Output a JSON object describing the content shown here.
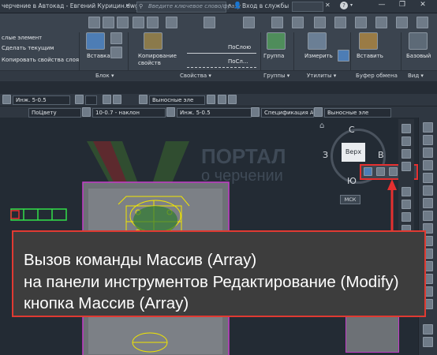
{
  "window": {
    "title": "черчение в Автокад - Евгений Курицин.dwg",
    "search_placeholder": "Введите ключевое слово/фразу",
    "signin": "Вход в службы",
    "help": "?"
  },
  "ribbon": {
    "layer_items": [
      "слые элемент",
      "Сделать текущим",
      "Копировать свойства слоя"
    ],
    "insert_label": "Вставка",
    "copy_props_label": "Копирование свойств",
    "by_layer_1": "ПоСлою",
    "by_layer_2": "ПоСл...",
    "group_label": "Группа",
    "measure_label": "Измерить",
    "paste_label": "Вставить",
    "base_label": "Базовый",
    "panels": [
      "Блок ▾",
      "Свойства ▾",
      "Группы ▾",
      "Утилиты ▾",
      "Буфер обмена",
      "Вид ▾"
    ]
  },
  "toolbar1": {
    "layer_combo": "Инж. 5-0.5",
    "mleader_combo": "Выносные эле"
  },
  "toolbar2": {
    "color_combo": "ПоЦвету",
    "line_combo": "10-0.7 - наклон",
    "layer_combo": "Инж. 5-0.5",
    "spec_combo": "Спецификация А",
    "mleader_combo": "Выносные эле"
  },
  "viewcube": {
    "north": "С",
    "south": "Ю",
    "west": "З",
    "east": "В",
    "face": "Верх",
    "wcs": "МСК"
  },
  "watermark": {
    "line1": "ПОРТАЛ",
    "line2": "о черчении"
  },
  "annotation": {
    "line1": "Вызов команды Массив (Array)",
    "line2": "на панели инструментов Редактирование (Modify)",
    "line3": "кнопка Массив (Array)"
  },
  "colors": {
    "accent_red": "#e03a32",
    "cad_yellow": "#f2e600",
    "cad_green": "#33e04a",
    "cad_magenta": "#c43cc9"
  }
}
